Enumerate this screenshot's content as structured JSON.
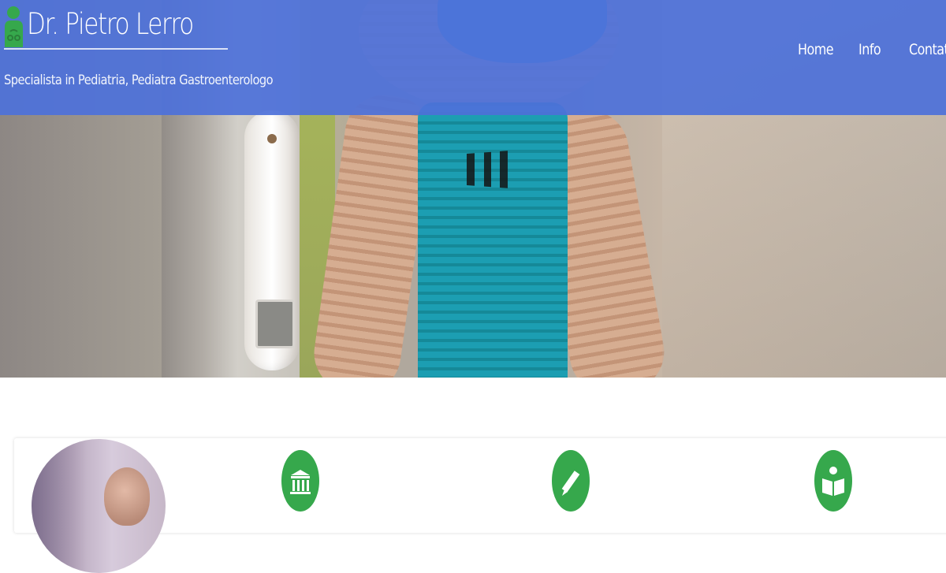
{
  "header": {
    "brand_title": "Dr. Pietro Lerro",
    "subtitle": "Specialista in Pediatria, Pediatra Gastroenterologo",
    "brand_icon": "doctor-person-icon",
    "accent_color": "#4e71d9",
    "icon_color": "#36a84c"
  },
  "nav": {
    "items": [
      {
        "label": "Home"
      },
      {
        "label": "Info"
      },
      {
        "label": "Contatti"
      }
    ]
  },
  "features": [
    {
      "icon": "bank-institution-icon"
    },
    {
      "icon": "pencil-edit-icon"
    },
    {
      "icon": "reader-book-icon"
    }
  ]
}
